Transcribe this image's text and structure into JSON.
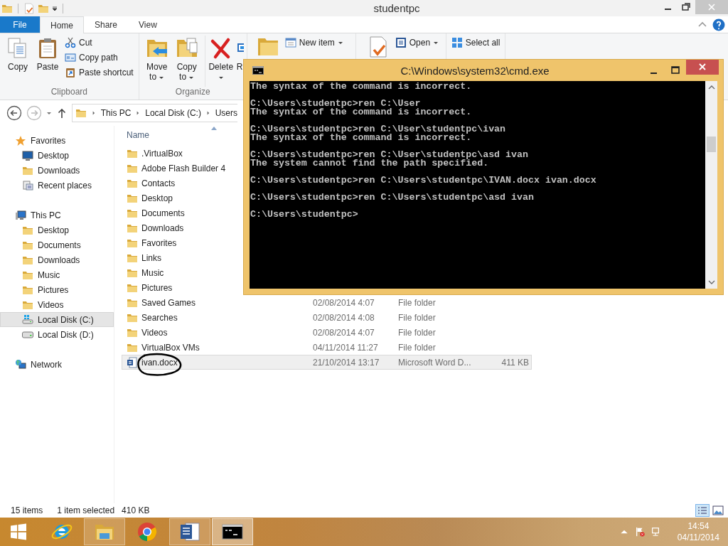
{
  "explorer": {
    "title": "studentpc",
    "tabs": [
      {
        "label": "File",
        "kind": "menu",
        "selected": false
      },
      {
        "label": "Home",
        "kind": "tab",
        "selected": true
      },
      {
        "label": "Share",
        "kind": "tab",
        "selected": false
      },
      {
        "label": "View",
        "kind": "tab",
        "selected": false
      }
    ],
    "ribbon_groups": [
      {
        "label": "Clipboard",
        "large": [
          {
            "label": "Copy",
            "kind": "copy"
          },
          {
            "label": "Paste",
            "kind": "paste"
          }
        ],
        "small": [
          {
            "label": "Cut",
            "kind": "cut"
          },
          {
            "label": "Copy path",
            "kind": "path"
          },
          {
            "label": "Paste shortcut",
            "kind": "shortcut"
          }
        ]
      },
      {
        "label": "Organize",
        "large": [
          {
            "label": "Move to",
            "kind": "move",
            "dropdown": true
          },
          {
            "label": "Copy to",
            "kind": "copyto",
            "dropdown": true
          },
          {
            "label": "Delete",
            "kind": "delete",
            "dropdown": true
          },
          {
            "label": "R",
            "kind": "rename"
          }
        ]
      },
      {
        "large": [
          {
            "kind": "newfolder"
          }
        ],
        "small": [
          {
            "label": "New item",
            "kind": "newitem",
            "dropdown": true
          }
        ]
      },
      {
        "large": [
          {
            "kind": "properties"
          }
        ],
        "small": [
          {
            "label": "Open",
            "kind": "open",
            "dropdown": true
          }
        ]
      },
      {
        "small": [
          {
            "label": "Select all",
            "kind": "selectall"
          }
        ]
      }
    ],
    "path": [
      "This PC",
      "Local Disk (C:)",
      "Users"
    ],
    "sidebar": [
      {
        "label": "Favorites",
        "kind": "star",
        "selected": false,
        "children": [
          {
            "label": "Desktop",
            "kind": "monitor",
            "selected": false
          },
          {
            "label": "Downloads",
            "kind": "folder",
            "selected": false
          },
          {
            "label": "Recent places",
            "kind": "recent",
            "selected": false
          }
        ]
      },
      {
        "label": "This PC",
        "kind": "pc",
        "selected": false,
        "children": [
          {
            "label": "Desktop",
            "kind": "folder",
            "selected": false
          },
          {
            "label": "Documents",
            "kind": "folder",
            "selected": false
          },
          {
            "label": "Downloads",
            "kind": "folder",
            "selected": false
          },
          {
            "label": "Music",
            "kind": "folder",
            "selected": false
          },
          {
            "label": "Pictures",
            "kind": "folder",
            "selected": false
          },
          {
            "label": "Videos",
            "kind": "folder",
            "selected": false
          },
          {
            "label": "Local Disk (C:)",
            "kind": "sysdrive",
            "selected": true
          },
          {
            "label": "Local Disk (D:)",
            "kind": "drive",
            "selected": false
          }
        ]
      },
      {
        "label": "Network",
        "kind": "network",
        "selected": false
      }
    ],
    "name_column": "Name",
    "files": [
      {
        "name": ".VirtualBox",
        "kind": "folder",
        "selected": false,
        "circled": false
      },
      {
        "name": "Adobe Flash Builder 4",
        "kind": "folder",
        "selected": false,
        "circled": false
      },
      {
        "name": "Contacts",
        "kind": "folder",
        "selected": false,
        "circled": false
      },
      {
        "name": "Desktop",
        "kind": "folder",
        "selected": false,
        "circled": false
      },
      {
        "name": "Documents",
        "kind": "folder",
        "selected": false,
        "circled": false
      },
      {
        "name": "Downloads",
        "kind": "folder",
        "selected": false,
        "circled": false
      },
      {
        "name": "Favorites",
        "kind": "folder",
        "selected": false,
        "circled": false
      },
      {
        "name": "Links",
        "kind": "folder",
        "selected": false,
        "circled": false
      },
      {
        "name": "Music",
        "kind": "folder",
        "selected": false,
        "circled": false
      },
      {
        "name": "Pictures",
        "kind": "folder",
        "selected": false,
        "circled": false
      },
      {
        "name": "Saved Games",
        "kind": "folder",
        "date": "02/08/2014 4:07",
        "type": "File folder",
        "selected": false,
        "circled": false
      },
      {
        "name": "Searches",
        "kind": "folder",
        "date": "02/08/2014 4:08",
        "type": "File folder",
        "selected": false,
        "circled": false
      },
      {
        "name": "Videos",
        "kind": "folder",
        "date": "02/08/2014 4:07",
        "type": "File folder",
        "selected": false,
        "circled": false
      },
      {
        "name": "VirtualBox VMs",
        "kind": "folder",
        "date": "04/11/2014 11:27",
        "type": "File folder",
        "selected": false,
        "circled": false
      },
      {
        "name": "ivan.docx",
        "kind": "word",
        "date": "21/10/2014 13:17",
        "type": "Microsoft Word D...",
        "size": "411 KB",
        "selected": true,
        "circled": true
      }
    ],
    "status": {
      "count": "15 items",
      "selection": "1 item selected",
      "size": "410 KB"
    }
  },
  "console": {
    "title": "C:\\Windows\\system32\\cmd.exe",
    "blocks": [
      [
        "The syntax of the command is incorrect."
      ],
      [
        "C:\\Users\\studentpc>ren C:\\User",
        "The syntax of the command is incorrect."
      ],
      [
        "C:\\Users\\studentpc>ren C:\\User\\studentpc\\ivan",
        "The syntax of the command is incorrect."
      ],
      [
        "C:\\Users\\studentpc>ren C:\\User\\studentpc\\asd ivan",
        "The system cannot find the path specified."
      ],
      [
        "C:\\Users\\studentpc>ren C:\\Users\\studentpc\\IVAN.docx ivan.docx"
      ],
      [
        "C:\\Users\\studentpc>ren C:\\Users\\studentpc\\asd ivan"
      ],
      [
        "C:\\Users\\studentpc>"
      ]
    ]
  },
  "taskbar": {
    "apps": [
      {
        "kind": "ie",
        "running": false,
        "active": false
      },
      {
        "kind": "explorer",
        "running": true,
        "active": false
      },
      {
        "kind": "chrome",
        "running": false,
        "active": false
      },
      {
        "kind": "word",
        "running": true,
        "active": false
      },
      {
        "kind": "cmd",
        "running": true,
        "active": true
      }
    ],
    "time": "14:54",
    "date": "04/11/2014"
  }
}
